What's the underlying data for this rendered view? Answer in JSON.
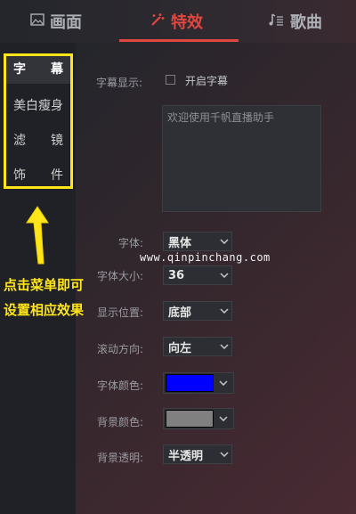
{
  "tabs": [
    {
      "label": "画面",
      "icon": "image-icon",
      "active": false
    },
    {
      "label": "特效",
      "icon": "magic-wand-icon",
      "active": true
    },
    {
      "label": "歌曲",
      "icon": "music-list-icon",
      "active": false
    }
  ],
  "sidebar": {
    "items": [
      {
        "label_a": "字",
        "label_b": "幕",
        "active": true
      },
      {
        "label_a": "美白瘦身",
        "label_b": "",
        "active": false
      },
      {
        "label_a": "滤",
        "label_b": "镜",
        "active": false
      },
      {
        "label_a": "饰",
        "label_b": "件",
        "active": false
      }
    ]
  },
  "annotation": {
    "line1": "点击菜单即可",
    "line2": "设置相应效果",
    "color": "#ffe51a"
  },
  "subtitle": {
    "display_label": "字幕显示:",
    "enable_label": "开启字幕",
    "enabled": false,
    "text": "欢迎使用千帆直播助手"
  },
  "settings": {
    "font_label": "字体:",
    "font_value": "黑体",
    "size_label": "字体大小:",
    "size_value": "36",
    "position_label": "显示位置:",
    "position_value": "底部",
    "scroll_label": "滚动方向:",
    "scroll_value": "向左",
    "font_color_label": "字体颜色:",
    "font_color": "#0000ff",
    "bg_color_label": "背景颜色:",
    "bg_color": "#808080",
    "opacity_label": "背景透明:",
    "opacity_value": "半透明"
  },
  "watermark": "www.qinpinchang.com",
  "accent": "#e2473f"
}
